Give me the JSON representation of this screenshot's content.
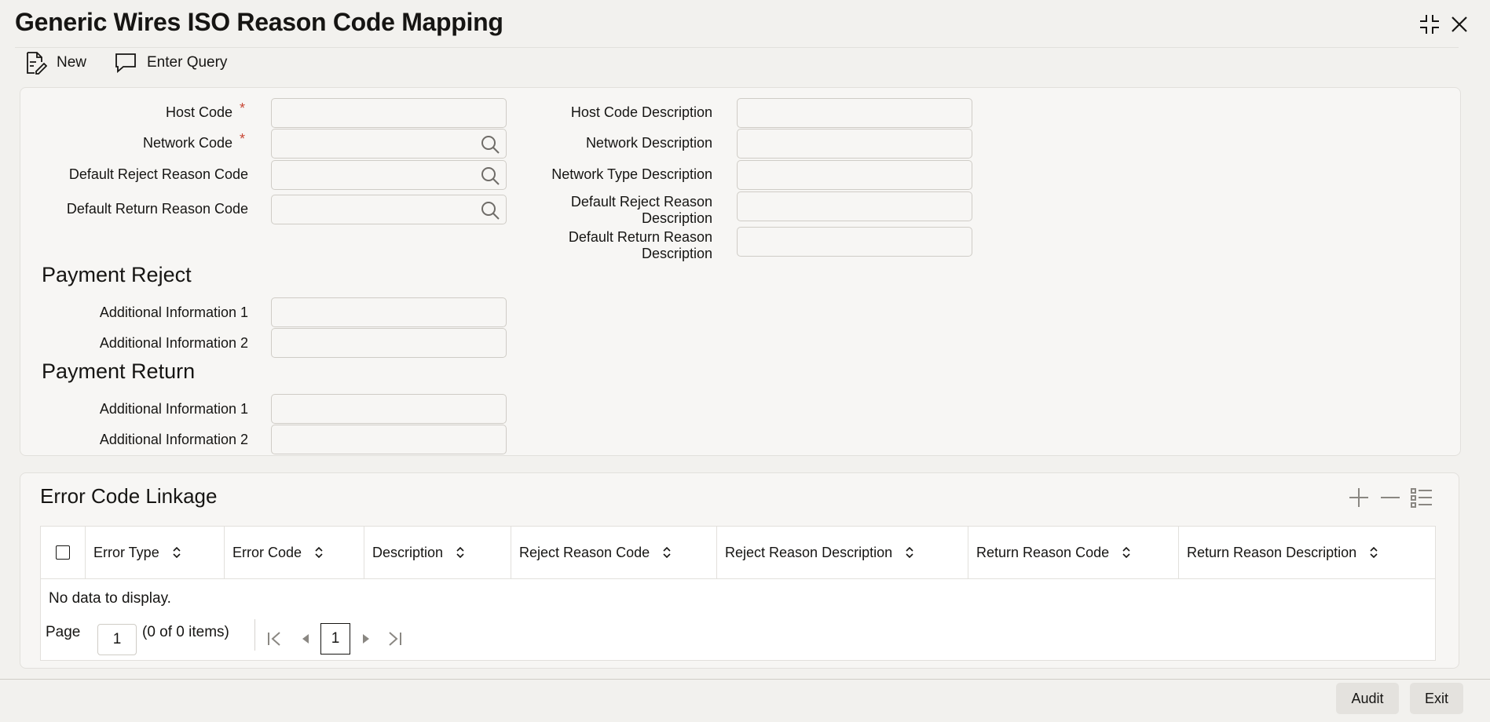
{
  "window": {
    "title": "Generic Wires ISO Reason Code Mapping"
  },
  "toolbar": {
    "new_label": "New",
    "enter_query_label": "Enter Query"
  },
  "form": {
    "host_code_label": "Host Code",
    "network_code_label": "Network Code",
    "default_reject_label": "Default Reject Reason Code",
    "default_return_label": "Default Return Reason Code",
    "host_desc_label": "Host Code Description",
    "network_desc_label": "Network Description",
    "network_type_desc_label": "Network Type Description",
    "reject_desc_label_1": "Default Reject Reason",
    "reject_desc_label_2": "Description",
    "return_desc_label_1": "Default Return Reason",
    "return_desc_label_2": "Description",
    "required_mark": "*"
  },
  "payment_reject": {
    "title": "Payment Reject",
    "info1_label": "Additional Information 1",
    "info2_label": "Additional Information 2"
  },
  "payment_return": {
    "title": "Payment Return",
    "info1_label": "Additional Information 1",
    "info2_label": "Additional Information 2"
  },
  "linkage": {
    "title": "Error Code Linkage",
    "columns": [
      "Error Type",
      "Error Code",
      "Description",
      "Reject Reason Code",
      "Reject Reason Description",
      "Return Reason Code",
      "Return Reason Description"
    ],
    "empty_text": "No data to display.",
    "page_label": "Page",
    "page_value": "1",
    "items_text": "(0 of 0 items)",
    "current_page": "1"
  },
  "footer": {
    "audit_label": "Audit",
    "exit_label": "Exit"
  },
  "icons": [
    "new-icon",
    "enter-query-icon",
    "minimize-icon",
    "close-icon",
    "search-icon",
    "add-row-icon",
    "delete-row-icon",
    "single-record-view-icon",
    "sort-icon",
    "first-page-icon",
    "previous-page-icon",
    "next-page-icon",
    "last-page-icon"
  ],
  "colors": {
    "required": "#c74634",
    "background": "#f2f1ee",
    "panel": "#f7f6f4"
  }
}
